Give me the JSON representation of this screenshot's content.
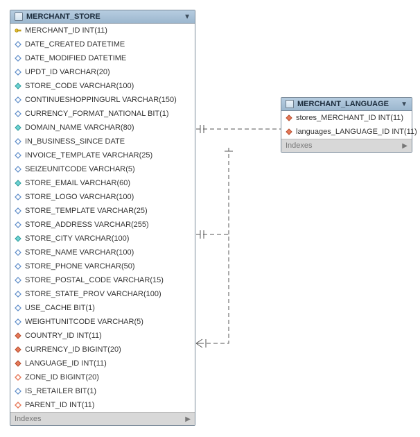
{
  "entities": {
    "merchant_store": {
      "title": "MERCHANT_STORE",
      "footer": "Indexes",
      "columns": [
        {
          "icon": "pk",
          "label": "MERCHANT_ID INT(11)"
        },
        {
          "icon": "attr",
          "label": "DATE_CREATED DATETIME"
        },
        {
          "icon": "attr",
          "label": "DATE_MODIFIED DATETIME"
        },
        {
          "icon": "attr",
          "label": "UPDT_ID VARCHAR(20)"
        },
        {
          "icon": "idx",
          "label": "STORE_CODE VARCHAR(100)"
        },
        {
          "icon": "attr",
          "label": "CONTINUESHOPPINGURL VARCHAR(150)"
        },
        {
          "icon": "attr",
          "label": "CURRENCY_FORMAT_NATIONAL BIT(1)"
        },
        {
          "icon": "idx",
          "label": "DOMAIN_NAME VARCHAR(80)"
        },
        {
          "icon": "attr",
          "label": "IN_BUSINESS_SINCE DATE"
        },
        {
          "icon": "attr",
          "label": "INVOICE_TEMPLATE VARCHAR(25)"
        },
        {
          "icon": "attr",
          "label": "SEIZEUNITCODE VARCHAR(5)"
        },
        {
          "icon": "idx",
          "label": "STORE_EMAIL VARCHAR(60)"
        },
        {
          "icon": "attr",
          "label": "STORE_LOGO VARCHAR(100)"
        },
        {
          "icon": "attr",
          "label": "STORE_TEMPLATE VARCHAR(25)"
        },
        {
          "icon": "attr",
          "label": "STORE_ADDRESS VARCHAR(255)"
        },
        {
          "icon": "idx",
          "label": "STORE_CITY VARCHAR(100)"
        },
        {
          "icon": "attr",
          "label": "STORE_NAME VARCHAR(100)"
        },
        {
          "icon": "attr",
          "label": "STORE_PHONE VARCHAR(50)"
        },
        {
          "icon": "attr",
          "label": "STORE_POSTAL_CODE VARCHAR(15)"
        },
        {
          "icon": "attr",
          "label": "STORE_STATE_PROV VARCHAR(100)"
        },
        {
          "icon": "attr",
          "label": "USE_CACHE BIT(1)"
        },
        {
          "icon": "attr",
          "label": "WEIGHTUNITCODE VARCHAR(5)"
        },
        {
          "icon": "fk",
          "label": "COUNTRY_ID INT(11)"
        },
        {
          "icon": "fk",
          "label": "CURRENCY_ID BIGINT(20)"
        },
        {
          "icon": "fk",
          "label": "LANGUAGE_ID INT(11)"
        },
        {
          "icon": "fk-open",
          "label": "ZONE_ID BIGINT(20)"
        },
        {
          "icon": "attr",
          "label": "IS_RETAILER BIT(1)"
        },
        {
          "icon": "fk-open",
          "label": "PARENT_ID INT(11)"
        }
      ]
    },
    "merchant_language": {
      "title": "MERCHANT_LANGUAGE",
      "footer": "Indexes",
      "columns": [
        {
          "icon": "fk",
          "label": "stores_MERCHANT_ID INT(11)"
        },
        {
          "icon": "fk",
          "label": "languages_LANGUAGE_ID INT(11)"
        }
      ]
    }
  }
}
